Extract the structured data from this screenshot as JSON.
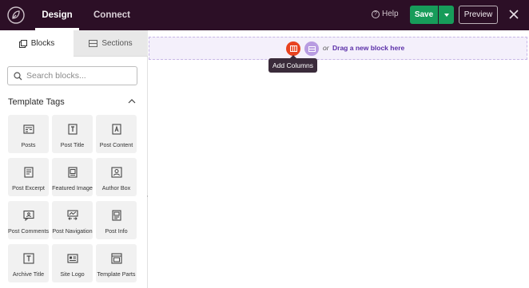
{
  "header": {
    "tabs": [
      {
        "label": "Design",
        "active": true
      },
      {
        "label": "Connect",
        "active": false
      }
    ],
    "help_label": "Help",
    "save_label": "Save",
    "preview_label": "Preview"
  },
  "sidebar": {
    "tabs": [
      {
        "label": "Blocks",
        "icon": "blocks-icon",
        "active": true
      },
      {
        "label": "Sections",
        "icon": "sections-icon",
        "active": false
      }
    ],
    "search_placeholder": "Search blocks...",
    "group_title": "Template Tags",
    "blocks": [
      {
        "label": "Posts",
        "icon": "posts-icon"
      },
      {
        "label": "Post Title",
        "icon": "post-title-icon"
      },
      {
        "label": "Post Content",
        "icon": "post-content-icon"
      },
      {
        "label": "Post Excerpt",
        "icon": "post-excerpt-icon"
      },
      {
        "label": "Featured Image",
        "icon": "featured-image-icon"
      },
      {
        "label": "Author Box",
        "icon": "author-box-icon"
      },
      {
        "label": "Post Comments",
        "icon": "post-comments-icon"
      },
      {
        "label": "Post Navigation",
        "icon": "post-navigation-icon"
      },
      {
        "label": "Post Info",
        "icon": "post-info-icon"
      },
      {
        "label": "Archive Title",
        "icon": "archive-title-icon"
      },
      {
        "label": "Site Logo",
        "icon": "site-logo-icon"
      },
      {
        "label": "Template Parts",
        "icon": "template-parts-icon"
      }
    ]
  },
  "canvas": {
    "or_text": "or",
    "drag_text": "Drag a new block here",
    "tooltip": "Add Columns"
  },
  "colors": {
    "topbar": "#2c0f26",
    "save": "#179c5a",
    "add_columns": "#e8421f",
    "add_block": "#b89ce1",
    "accent_text": "#5b2fa8"
  }
}
